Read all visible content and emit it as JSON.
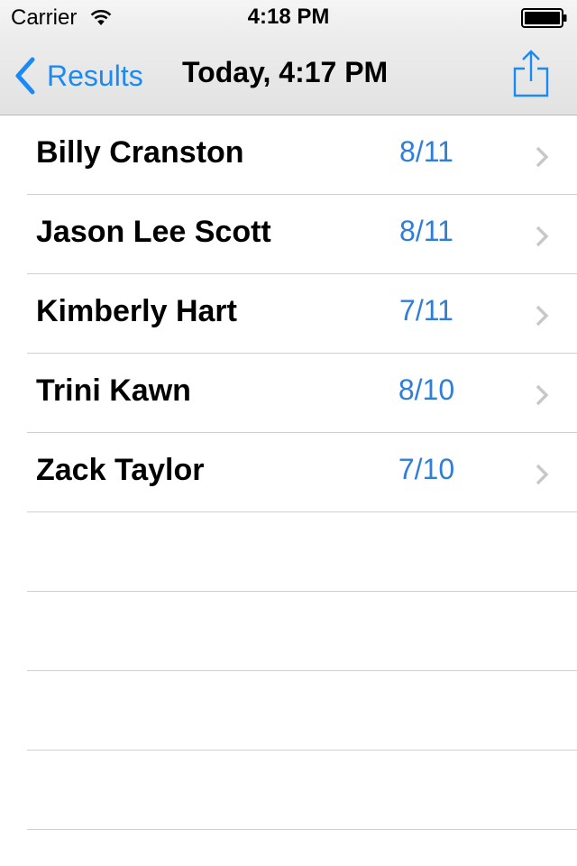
{
  "status_bar": {
    "carrier": "Carrier",
    "time": "4:18 PM",
    "icons": [
      "wifi-icon",
      "battery-icon"
    ]
  },
  "nav": {
    "back_label": "Results",
    "title": "Today, 4:17 PM",
    "back_icon": "chevron-left-icon",
    "share_icon": "share-icon"
  },
  "colors": {
    "tint": "#1a8af5",
    "score": "#2f7ed8",
    "separator": "#cfcfd2",
    "chevron": "#c7c7cc"
  },
  "results": [
    {
      "name": "Billy Cranston",
      "score": "8/11"
    },
    {
      "name": "Jason Lee Scott",
      "score": "8/11"
    },
    {
      "name": "Kimberly Hart",
      "score": "7/11"
    },
    {
      "name": "Trini Kawn",
      "score": "8/10"
    },
    {
      "name": "Zack Taylor",
      "score": "7/10"
    }
  ]
}
